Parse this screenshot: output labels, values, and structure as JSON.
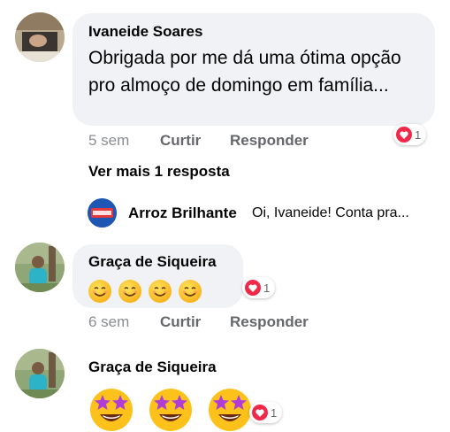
{
  "comments": [
    {
      "author": "Ivaneide Soares",
      "text": "Obrigada por me dá uma ótima opção pro almoço de domingo em família...",
      "time": "5 sem",
      "like_label": "Curtir",
      "reply_label": "Responder",
      "reaction_count": "1"
    },
    {
      "author": "Graça de Siqueira",
      "emojis": [
        "smiling-face-icon",
        "smiling-face-icon",
        "smiling-face-icon",
        "smiling-face-icon"
      ],
      "time": "6 sem",
      "like_label": "Curtir",
      "reply_label": "Responder",
      "reaction_count": "1"
    },
    {
      "author": "Graça de Siqueira",
      "emojis": [
        "star-struck-icon",
        "star-struck-icon",
        "star-struck-icon"
      ],
      "reaction_count": "1"
    }
  ],
  "view_more_replies": "Ver mais 1 resposta",
  "reply_preview": {
    "author": "Arroz Brilhante",
    "text": "Oi, Ivaneide! Conta pra..."
  },
  "colors": {
    "bubble": "#f0f2f5",
    "heart": "#f0284a",
    "meta": "#65676b"
  }
}
